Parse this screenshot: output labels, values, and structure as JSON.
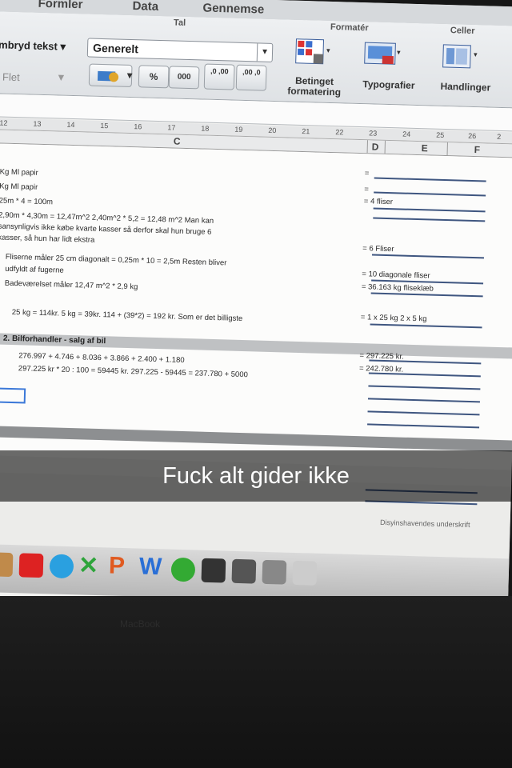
{
  "ribbon": {
    "tabs": [
      "Formler",
      "Data",
      "Gennemse"
    ],
    "groups": {
      "tal": "Tal",
      "formater": "Formatér",
      "celler": "Celler"
    },
    "wrap_text": "mbryd tekst",
    "merge": "Flet",
    "number_format": "Generelt",
    "percent": "%",
    "thousands": "000",
    "decimal_increase": ",0 ,00",
    "decimal_decrease": ",00 ,0",
    "conditional_formatting": "Betinget formatering",
    "styles": "Typografier",
    "actions": "Handlinger"
  },
  "ruler_numbers": [
    "12",
    "13",
    "14",
    "15",
    "16",
    "17",
    "18",
    "19",
    "20",
    "21",
    "22",
    "23",
    "24",
    "25",
    "26",
    "2"
  ],
  "columns": [
    "C",
    "D",
    "E",
    "F"
  ],
  "rows": [
    "Kg Ml papir",
    "Kg Ml papir",
    "25m * 4 = 100m",
    "2,90m * 4,30m = 12,47m^2  2,40m^2 * 5,2 = 12,48 m^2 Man kan",
    "sansynligvis ikke købe kvarte kasser så derfor skal hun bruge 6",
    "kasser, så hun har lidt ekstra",
    "Fliserne måler 25 cm diagonalt = 0,25m * 10 = 2,5m Resten bliver",
    "udfyldt af fugerne",
    "Badeværelset måler 12,47 m^2 * 2,9 kg",
    "25 kg = 114kr.  5 kg = 39kr.  114 + (39*2) = 192 kr. Som er det billigste"
  ],
  "answers": [
    "=",
    "=",
    "= 4 fliser",
    "= 6 Fliser",
    "= 10 diagonale fliser",
    "= 36.163 kg fliseklæb",
    "= 1 x 25 kg 2 x 5 kg"
  ],
  "section2": {
    "title": "2. Bilforhandler - salg af bil",
    "line1": "276.997 + 4.746 + 8.036 + 3.866 + 2.400 + 1.180",
    "line2": "297.225 kr * 20 : 100 = 59445 kr. 297.225 - 59445 = 237.780 + 5000",
    "answers": [
      "= 297.225 kr.",
      "= 242.780 kr."
    ]
  },
  "footer": {
    "signature": "Disyinshavendes underskrift"
  },
  "dock": {
    "p_glyph": "P",
    "w_glyph": "W"
  },
  "bezel_brand": "MacBook",
  "caption": "Fuck alt gider ikke"
}
